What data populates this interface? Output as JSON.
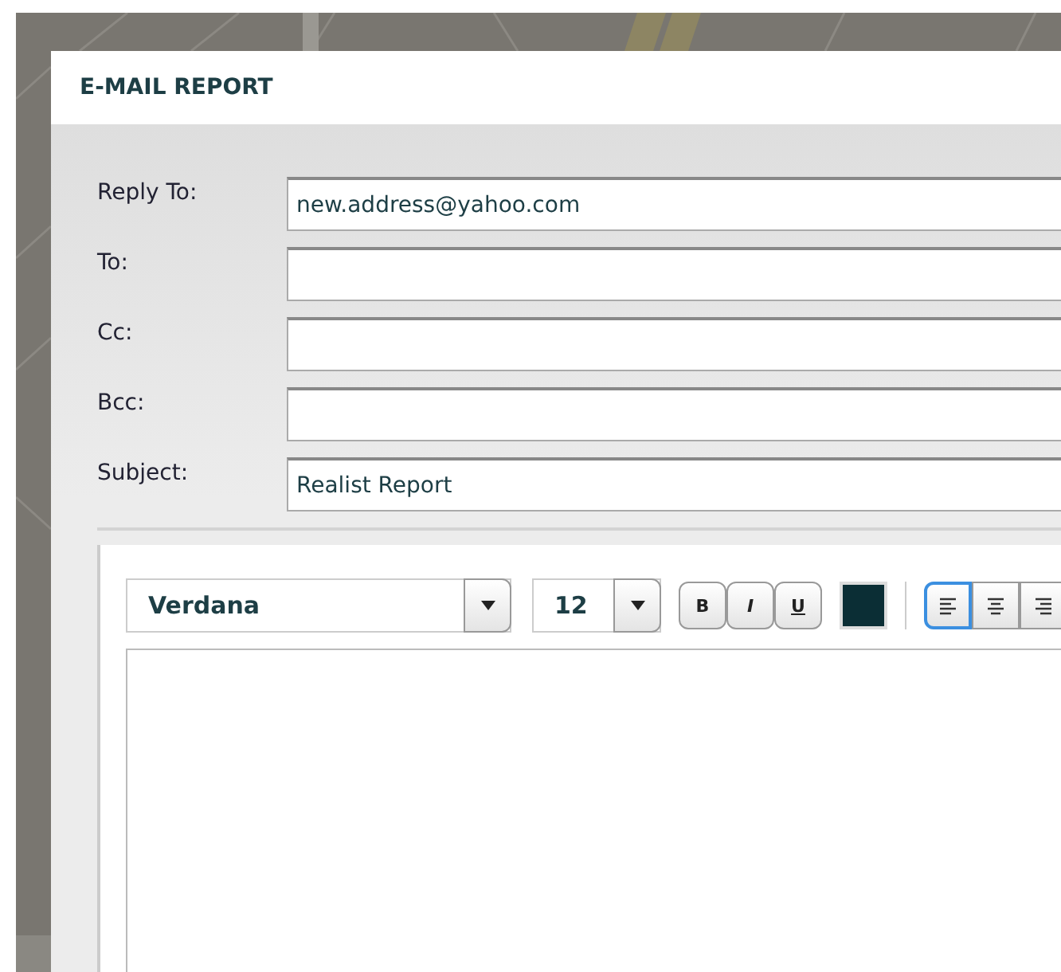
{
  "dialog": {
    "title": "E-MAIL REPORT"
  },
  "fields": [
    {
      "label": "Reply To:",
      "value": "new.address@yahoo.com"
    },
    {
      "label": "To:"
    },
    {
      "label": "Cc:"
    },
    {
      "label": "Bcc:"
    },
    {
      "label": "Subject:",
      "value": "Realist Report"
    }
  ],
  "editor": {
    "font": "Verdana",
    "size": "12",
    "styles": [
      "B",
      "I",
      "U"
    ],
    "alignments": [
      {
        "kind": "left",
        "selected": true
      },
      {
        "kind": "center",
        "selected": false
      },
      {
        "kind": "right",
        "selected": false
      }
    ]
  }
}
